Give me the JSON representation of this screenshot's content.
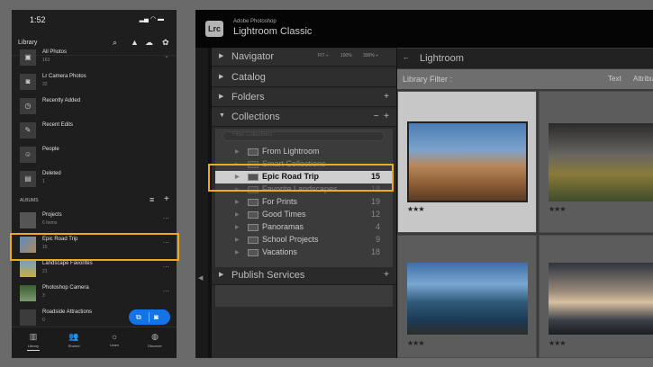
{
  "phone": {
    "time": "1:52",
    "title": "Library",
    "icons": [
      "search-icon",
      "bell-icon",
      "cloud-icon",
      "gear-icon"
    ],
    "items": [
      {
        "name": "All Photos",
        "count": "163",
        "icon": "image-icon"
      },
      {
        "name": "Lr Camera Photos",
        "count": "32",
        "icon": "camera-icon"
      },
      {
        "name": "Recently Added",
        "count": "",
        "icon": "clock-icon"
      },
      {
        "name": "Recent Edits",
        "count": "",
        "icon": "edit-icon"
      },
      {
        "name": "People",
        "count": "",
        "icon": "person-icon"
      },
      {
        "name": "Deleted",
        "count": "1",
        "icon": "trash-icon"
      }
    ],
    "albums_label": "ALBUMS",
    "albums": [
      {
        "name": "Projects",
        "count": "6 Items"
      },
      {
        "name": "Epic Road Trip",
        "count": "15"
      },
      {
        "name": "Landscape Favorites",
        "count": "21"
      },
      {
        "name": "Photoshop Camera",
        "count": "3"
      },
      {
        "name": "Roadside Attractions",
        "count": "0"
      }
    ],
    "tabs": [
      "Library",
      "Shared",
      "Learn",
      "Discover"
    ]
  },
  "lrc": {
    "brand_small": "Adobe Photoshop",
    "brand_large": "Lightroom Classic",
    "logo": "Lrc",
    "navigator": "Navigator",
    "nav_zoom": [
      "FIT ÷",
      "100%",
      "300% ÷"
    ],
    "catalog": "Catalog",
    "folders": "Folders",
    "collections": "Collections",
    "filter_placeholder": "Filter Collections",
    "collection_items": [
      {
        "name": "From Lightroom",
        "count": ""
      },
      {
        "name": "Smart Collections",
        "count": ""
      },
      {
        "name": "Epic Road Trip",
        "count": "15"
      },
      {
        "name": "Favorite Landscapes",
        "count": "18"
      },
      {
        "name": "For Prints",
        "count": "19"
      },
      {
        "name": "Good Times",
        "count": "12"
      },
      {
        "name": "Panoramas",
        "count": "4"
      },
      {
        "name": "School Projects",
        "count": "9"
      },
      {
        "name": "Vacations",
        "count": "18"
      }
    ],
    "publish": "Publish Services",
    "grid_title": "Lightroom",
    "library_filter": "Library Filter :",
    "filter_text": "Text",
    "filter_attr": "Attribute",
    "ratings": [
      "★★★",
      "★★★",
      "★★★",
      "★★★"
    ]
  }
}
